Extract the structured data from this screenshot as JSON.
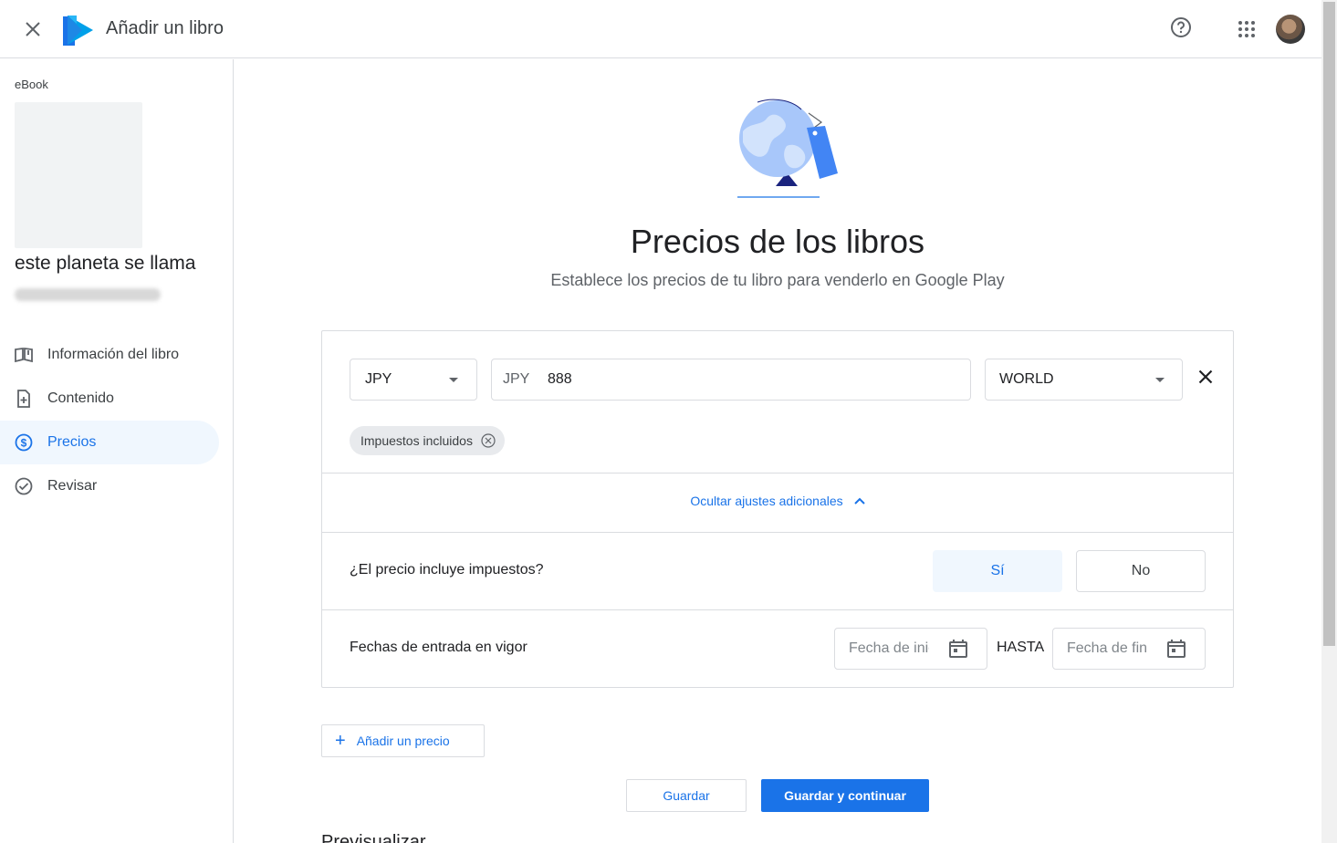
{
  "header": {
    "title": "Añadir un libro",
    "close_icon": "close-icon",
    "help_icon": "help-circle-icon",
    "apps_icon": "apps-grid-icon"
  },
  "sidebar": {
    "format": "eBook",
    "book_title": "este planeta se llama",
    "items": [
      {
        "label": "Información del libro",
        "icon": "book-info-icon",
        "active": false
      },
      {
        "label": "Contenido",
        "icon": "document-add-icon",
        "active": false
      },
      {
        "label": "Precios",
        "icon": "dollar-circle-icon",
        "active": true
      },
      {
        "label": "Revisar",
        "icon": "check-circle-icon",
        "active": false
      }
    ]
  },
  "main": {
    "title": "Precios de los libros",
    "subtitle": "Establece los precios de tu libro para venderlo en Google Play",
    "price_entry": {
      "currency": "JPY",
      "price_prefix": "JPY",
      "amount": "888",
      "region": "WORLD"
    },
    "chip_label": "Impuestos incluidos",
    "toggle_settings_label": "Ocultar ajustes adicionales",
    "tax_question": "¿El precio incluye impuestos?",
    "tax_yes": "Sí",
    "tax_no": "No",
    "dates_label": "Fechas de entrada en vigor",
    "start_date_placeholder": "Fecha de inicio",
    "end_date_placeholder": "Fecha de fin",
    "until_label": "HASTA",
    "add_price_label": "Añadir un precio",
    "save_label": "Guardar",
    "save_continue_label": "Guardar y continuar",
    "next_section_heading": "Previsualizar"
  },
  "colors": {
    "accent": "#1a73e8",
    "active_nav_bg": "#f0f7fe",
    "border": "#dadce0"
  }
}
